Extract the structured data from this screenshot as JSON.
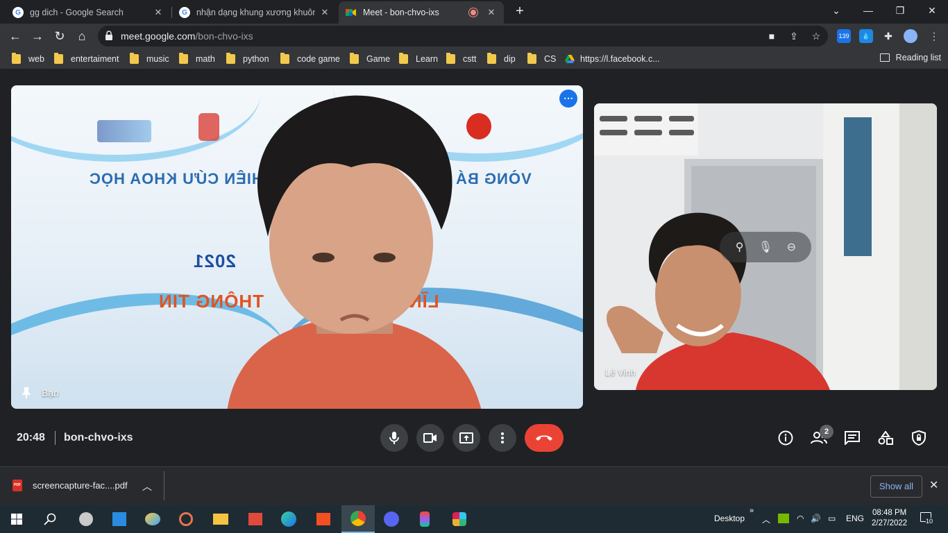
{
  "browser": {
    "tabs": [
      {
        "title": "gg dich - Google Search",
        "favicon": "google-icon"
      },
      {
        "title": "nhận dạng khung xương khuôn mặt",
        "favicon": "google-icon"
      },
      {
        "title": "Meet - bon-chvo-ixs",
        "favicon": "meet-icon",
        "active": true
      }
    ],
    "new_tab": "+",
    "url_host": "meet.google.com",
    "url_path": "/bon-chvo-ixs",
    "extension_badge": "139",
    "bookmarks": [
      "web",
      "entertaiment",
      "music",
      "math",
      "python",
      "code game",
      "Game",
      "Learn",
      "cstt",
      "dip",
      "CS",
      "https://l.facebook.c..."
    ],
    "reading_list": "Reading list"
  },
  "meet": {
    "main_tile": {
      "label": "Bạn",
      "background_text": {
        "line1": "VÒNG BÁ",
        "line1b": "HIÊN CỨU KHOA HỌC",
        "year": "2021",
        "field": "LĨNH",
        "field_b": "THÔNG TIN"
      }
    },
    "side_tile": {
      "label": "Lê Vinh"
    },
    "time": "20:48",
    "meeting_code": "bon-chvo-ixs",
    "participants_count": "2"
  },
  "downloads": {
    "file": "screencapture-fac....pdf",
    "show_all": "Show all"
  },
  "taskbar": {
    "desktop_label": "Desktop",
    "lang": "ENG",
    "time": "08:48 PM",
    "date": "2/27/2022",
    "notifications": "10"
  },
  "colors": {
    "end_call": "#ea4335",
    "accent_blue": "#1a73e8",
    "bg": "#202124"
  }
}
